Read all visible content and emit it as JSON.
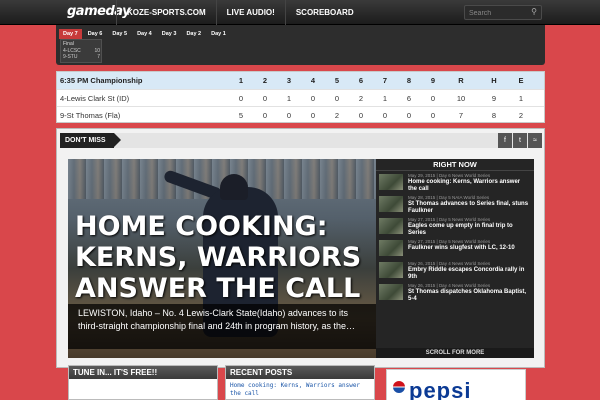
{
  "logo": "gameday",
  "nav": [
    "KOZE-SPORTS.COM",
    "LIVE AUDIO!",
    "SCOREBOARD"
  ],
  "search": {
    "placeholder": "Search"
  },
  "days": [
    "Day 7",
    "Day 6",
    "Day 5",
    "Day 4",
    "Day 3",
    "Day 2",
    "Day 1"
  ],
  "minibox": {
    "status": "Final",
    "rows": [
      {
        "team": "4-LCSC",
        "score": "10"
      },
      {
        "team": "9-STU",
        "score": "7"
      }
    ]
  },
  "linescore": {
    "title": "6:35 PM Championship",
    "headers": [
      "1",
      "2",
      "3",
      "4",
      "5",
      "6",
      "7",
      "8",
      "9",
      "R",
      "H",
      "E"
    ],
    "rows": [
      {
        "team": "4-Lewis Clark St (ID)",
        "cells": [
          "0",
          "0",
          "1",
          "0",
          "0",
          "2",
          "1",
          "6",
          "0",
          "10",
          "9",
          "1"
        ]
      },
      {
        "team": "9-St Thomas (Fla)",
        "cells": [
          "5",
          "0",
          "0",
          "0",
          "2",
          "0",
          "0",
          "0",
          "0",
          "7",
          "8",
          "2"
        ]
      }
    ]
  },
  "dont_miss": "DON'T MISS",
  "hero": {
    "title": "HOME COOKING: KERNS, WARRIORS ANSWER THE CALL",
    "excerpt": "LEWISTON, Idaho – No. 4 Lewis-Clark State(Idaho) advances to its third-straight championship final and 24th in program history, as the…"
  },
  "right_now": {
    "heading": "RIGHT NOW",
    "items": [
      {
        "meta": "May 29, 2015 | Day 6 News World Series",
        "title": "Home cooking: Kerns, Warriors answer the call"
      },
      {
        "meta": "May 28, 2015 | Day 5 NAIA World Series",
        "title": "St Thomas advances to Series final, stuns Faulkner"
      },
      {
        "meta": "May 27, 2015 | Day 5 News World Series",
        "title": "Eagles come up empty in final trip to Series"
      },
      {
        "meta": "May 27, 2015 | Day 5 News World Series",
        "title": "Faulkner wins slugfest with LC, 12-10"
      },
      {
        "meta": "May 26, 2015 | Day 4 News World Series",
        "title": "Embry Riddle escapes Concordia rally in 9th"
      },
      {
        "meta": "May 26, 2015 | Day 4 News World Series",
        "title": "St Thomas dispatches Oklahoma Baptist, 5-4"
      }
    ],
    "scroll": "SCROLL FOR MORE"
  },
  "tune_in": "TUNE IN... IT'S FREE!!",
  "recent_posts": {
    "heading": "RECENT POSTS",
    "first": "Home cooking: Kerns, Warriors answer the call"
  },
  "ad": {
    "word": "pepsi"
  }
}
